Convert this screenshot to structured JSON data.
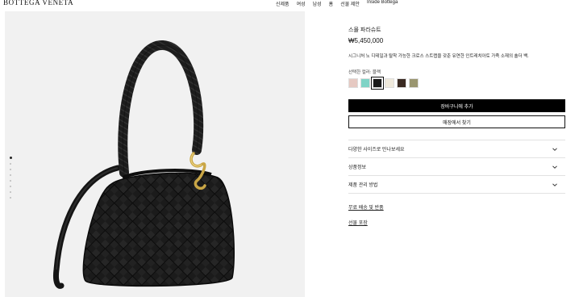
{
  "header": {
    "logo": "BOTTEGA VENETA",
    "nav": [
      "신제품",
      "여성",
      "남성",
      "홈",
      "선물 제안",
      "Inside Bottega"
    ]
  },
  "gallery": {
    "dot_count": 8,
    "active_index": 0
  },
  "product": {
    "name": "스몰 파라슈트",
    "price": "₩5,450,000",
    "description": "시그니처 노 디테일과 탈착 가능한 크로스 스트랩을 갖춘 유연한 인트레치아토 가죽 소재의 숄더 백.",
    "color_label": "선택한 컬러: 블랙",
    "swatches": [
      {
        "name": "rose",
        "color": "#e6c9c2"
      },
      {
        "name": "mint",
        "color": "#7fd3c6"
      },
      {
        "name": "black",
        "color": "#1a1a1a",
        "selected": true
      },
      {
        "name": "ivory",
        "color": "#efe9dc"
      },
      {
        "name": "dark-brown",
        "color": "#3a2a22"
      },
      {
        "name": "olive",
        "color": "#9a9670"
      }
    ],
    "add_to_cart": "장바구니에 추가",
    "find_in_store": "매장에서 찾기"
  },
  "accordion": [
    {
      "label": "다양한 사이즈로 만나보세요"
    },
    {
      "label": "상품정보"
    },
    {
      "label": "제품 관리 방법"
    }
  ],
  "links": {
    "shipping": "무료 배송 및 반품",
    "gift": "선물 포장"
  }
}
